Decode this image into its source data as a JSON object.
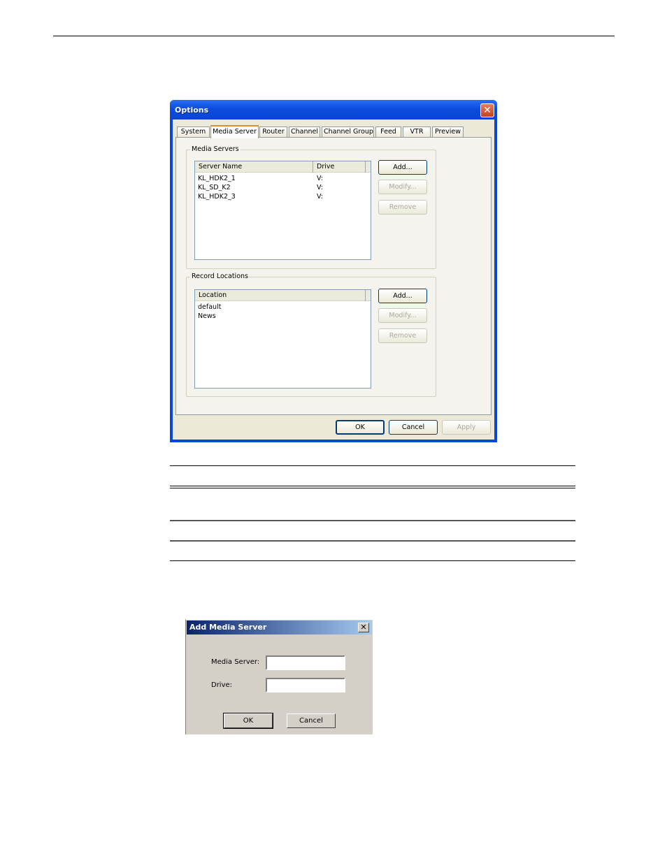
{
  "options_window": {
    "title": "Options",
    "tabs": [
      {
        "label": "System",
        "active": false
      },
      {
        "label": "Media Server",
        "active": true
      },
      {
        "label": "Router",
        "active": false
      },
      {
        "label": "Channel",
        "active": false
      },
      {
        "label": "Channel Group",
        "active": false
      },
      {
        "label": "Feed",
        "active": false
      },
      {
        "label": "VTR",
        "active": false
      },
      {
        "label": "Preview",
        "active": false
      }
    ],
    "media_servers": {
      "group_label": "Media Servers",
      "columns": [
        "Server Name",
        "Drive"
      ],
      "rows": [
        {
          "server_name": "KL_HDK2_1",
          "drive": "V:"
        },
        {
          "server_name": "KL_SD_K2",
          "drive": "V:"
        },
        {
          "server_name": "KL_HDK2_3",
          "drive": "V:"
        }
      ],
      "buttons": {
        "add": "Add...",
        "modify": "Modify...",
        "remove": "Remove"
      }
    },
    "record_locations": {
      "group_label": "Record Locations",
      "columns": [
        "Location"
      ],
      "rows": [
        "default",
        "News"
      ],
      "buttons": {
        "add": "Add...",
        "modify": "Modify...",
        "remove": "Remove"
      }
    },
    "footer_buttons": {
      "ok": "OK",
      "cancel": "Cancel",
      "apply": "Apply"
    }
  },
  "add_media_server_dialog": {
    "title": "Add Media Server",
    "media_server_label": "Media Server:",
    "media_server_value": "",
    "drive_label": "Drive:",
    "drive_value": "",
    "ok": "OK",
    "cancel": "Cancel"
  }
}
